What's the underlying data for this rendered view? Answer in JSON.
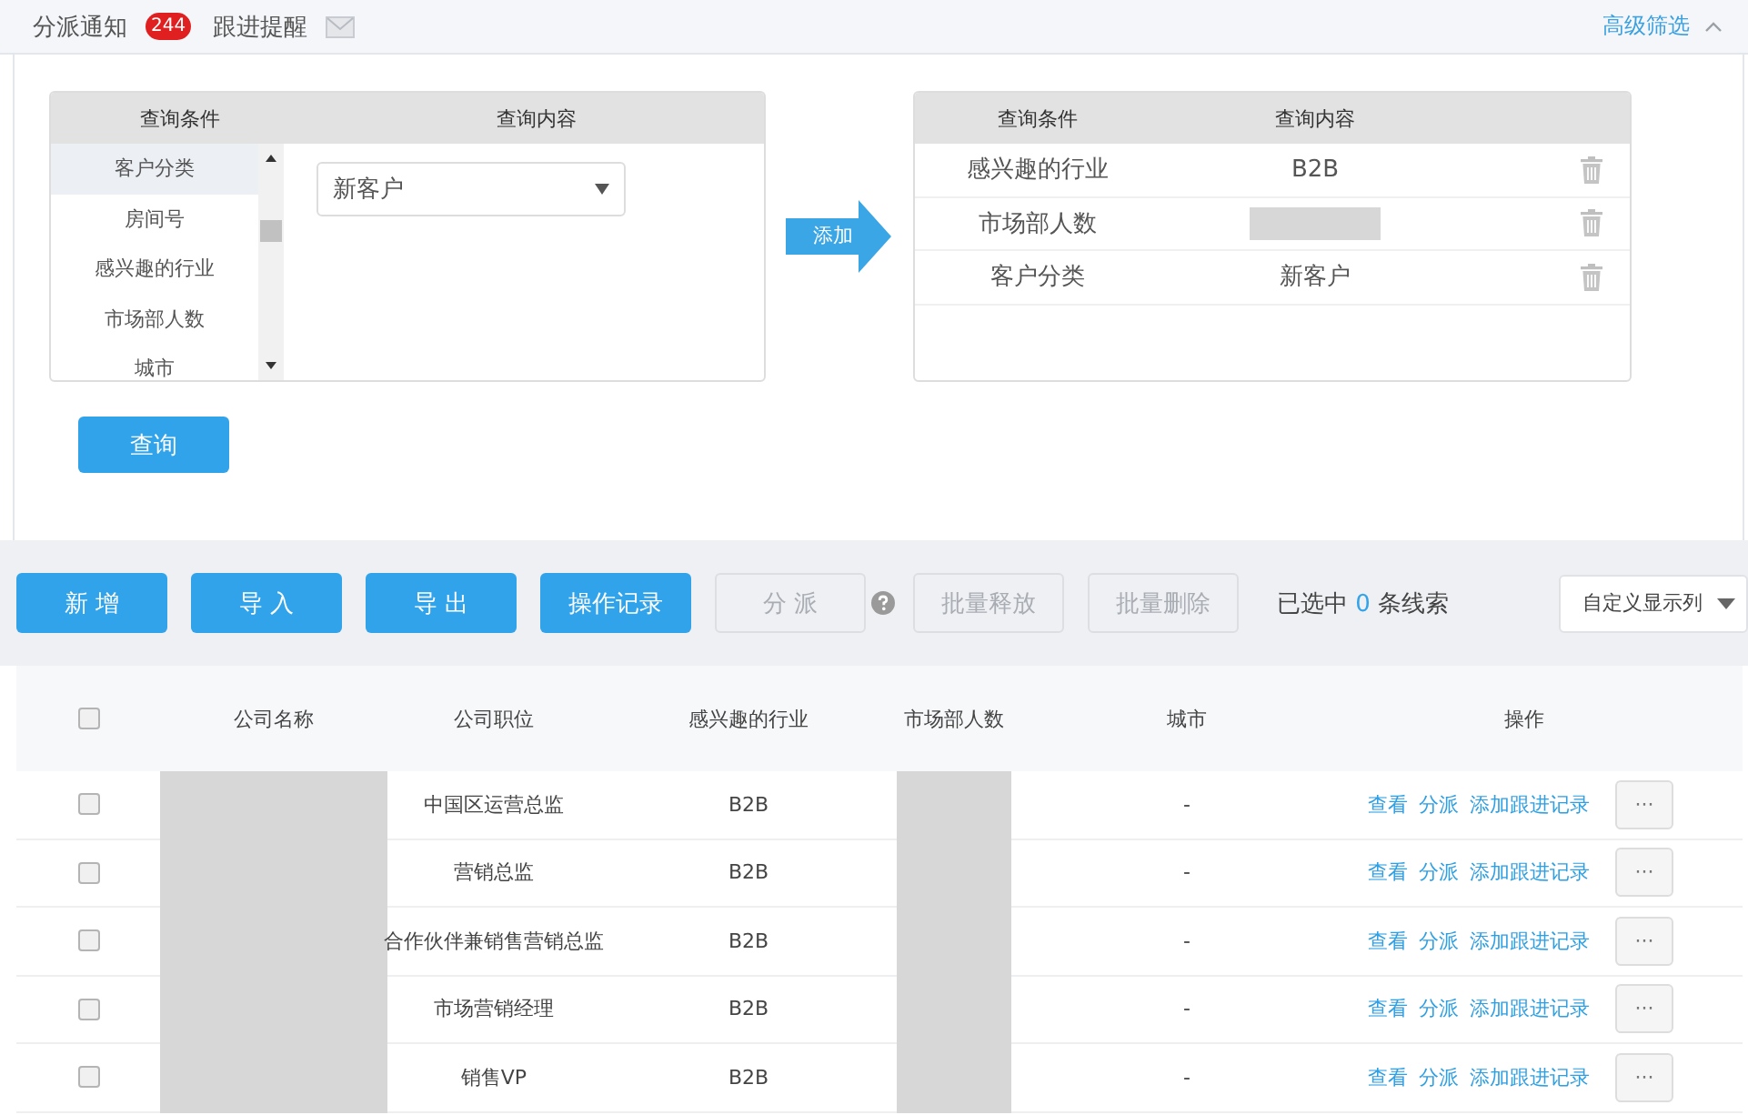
{
  "notifications": [
    {
      "kind": "badge",
      "label": "分派通知",
      "badge": "244"
    },
    {
      "kind": "mail",
      "label": "跟进提醒"
    }
  ],
  "advanced_filter": {
    "label": "高级筛选",
    "expanded": true
  },
  "query_builder": {
    "columns": [
      "查询条件",
      "查询内容"
    ],
    "conditions": [
      {
        "label": "客户分类",
        "selected": true
      },
      {
        "label": "房间号",
        "selected": false
      },
      {
        "label": "感兴趣的行业",
        "selected": false
      },
      {
        "label": "市场部人数",
        "selected": false
      },
      {
        "label": "城市",
        "selected": false
      }
    ],
    "value_select": {
      "value": "新客户"
    },
    "add_button": "添加"
  },
  "active_filters": {
    "columns": [
      "查询条件",
      "查询内容"
    ],
    "rows": [
      {
        "condition": "感兴趣的行业",
        "value": "B2B",
        "redacted": false
      },
      {
        "condition": "市场部人数",
        "redacted": true
      },
      {
        "condition": "客户分类",
        "value": "新客户",
        "redacted": false
      }
    ]
  },
  "search_button": "查询",
  "toolbar": {
    "buttons": [
      {
        "label": "新 增",
        "disabled": false
      },
      {
        "label": "导 入",
        "disabled": false
      },
      {
        "label": "导 出",
        "disabled": false
      },
      {
        "label": "操作记录",
        "disabled": false
      },
      {
        "label": "分 派",
        "disabled": true,
        "help": true
      },
      {
        "label": "批量释放",
        "disabled": true
      },
      {
        "label": "批量删除",
        "disabled": true
      }
    ],
    "selection": {
      "prefix": "已选中",
      "count": "0",
      "suffix": "条线索"
    },
    "column_select": {
      "value": "自定义显示列"
    }
  },
  "table": {
    "all_checked": false,
    "columns": [
      "公司名称",
      "公司职位",
      "感兴趣的行业",
      "市场部人数",
      "城市",
      "操作"
    ],
    "rows": [
      {
        "checked": false,
        "company_redacted": true,
        "position": "中国区运营总监",
        "industry": "B2B",
        "staff_redacted": true,
        "city": "-",
        "actions": [
          "查看",
          "分派",
          "添加跟进记录"
        ],
        "more": "···"
      },
      {
        "checked": false,
        "company_redacted": true,
        "position": "营销总监",
        "industry": "B2B",
        "staff_redacted": true,
        "city": "-",
        "actions": [
          "查看",
          "分派",
          "添加跟进记录"
        ],
        "more": "···"
      },
      {
        "checked": false,
        "company_redacted": true,
        "position": "合作伙伴兼销售营销总监",
        "industry": "B2B",
        "staff_redacted": true,
        "city": "-",
        "actions": [
          "查看",
          "分派",
          "添加跟进记录"
        ],
        "more": "···"
      },
      {
        "checked": false,
        "company_redacted": true,
        "position": "市场营销经理",
        "industry": "B2B",
        "staff_redacted": true,
        "city": "-",
        "actions": [
          "查看",
          "分派",
          "添加跟进记录"
        ],
        "more": "···"
      },
      {
        "checked": false,
        "company_redacted": true,
        "position": "销售VP",
        "industry": "B2B",
        "staff_redacted": true,
        "city": "-",
        "actions": [
          "查看",
          "分派",
          "添加跟进记录"
        ],
        "more": "···"
      }
    ]
  }
}
